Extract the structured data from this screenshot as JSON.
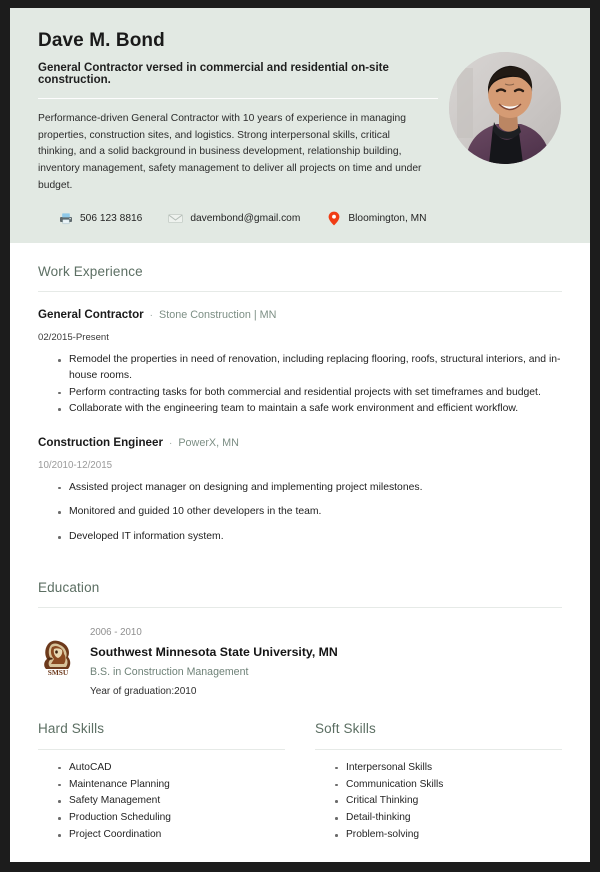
{
  "header": {
    "name": "Dave M. Bond",
    "headline": "General Contractor versed in commercial and residential on-site construction.",
    "summary": "Performance-driven General Contractor with 10 years of experience in managing properties, construction sites, and logistics. Strong interpersonal skills, critical thinking, and a solid background in business development, relationship building, inventory management, safety management to deliver all projects on time and under budget.",
    "background_color": "#e2e9e3",
    "photo": {
      "icon": "profile-photo",
      "description": "Smiling man with dark hair wearing a purple blazer and black turtleneck"
    },
    "contact": [
      {
        "icon": "phone-icon",
        "value": "506 123 8816"
      },
      {
        "icon": "envelope-icon",
        "value": "davembond@gmail.com"
      },
      {
        "icon": "map-pin-icon",
        "value": "Bloomington, MN"
      }
    ]
  },
  "work_experience": {
    "title": "Work Experience",
    "jobs": [
      {
        "title": "General Contractor",
        "separator": "·",
        "company": "Stone Construction | MN",
        "date": "02/2015-Present",
        "bullets": [
          "Remodel the properties in need of renovation, including replacing flooring, roofs, structural interiors, and in-house rooms.",
          "Perform contracting tasks for both commercial and residential projects with set timeframes and budget.",
          "Collaborate with the engineering team to maintain a safe work environment and efficient workflow."
        ]
      },
      {
        "title": "Construction Engineer",
        "separator": "·",
        "company": "PowerX, MN",
        "date": "10/2010-12/2015",
        "bullets": [
          "Assisted project manager on designing and implementing project milestones.",
          "Monitored and guided 10 other developers in the team.",
          "Developed IT information system."
        ]
      }
    ]
  },
  "education": {
    "title": "Education",
    "entries": [
      {
        "logo": "smsu-mustang-logo",
        "logo_text": "SMSU",
        "years": "2006 - 2010",
        "school": "Southwest Minnesota State University, MN",
        "degree": "B.S. in Construction Management",
        "graduation": "Year of graduation:2010"
      }
    ]
  },
  "skills": {
    "hard": {
      "title": "Hard Skills",
      "items": [
        "AutoCAD",
        "Maintenance Planning",
        "Safety Management",
        "Production Scheduling",
        "Project Coordination"
      ]
    },
    "soft": {
      "title": "Soft Skills",
      "items": [
        "Interpersonal Skills",
        "Communication Skills",
        "Critical Thinking",
        "Detail-thinking",
        "Problem-solving"
      ]
    }
  },
  "theme": {
    "heading_color": "#5c6f63",
    "accent_color": "#7d8f85",
    "pin_color": "#f03c14",
    "header_bg": "#e2e9e3"
  }
}
